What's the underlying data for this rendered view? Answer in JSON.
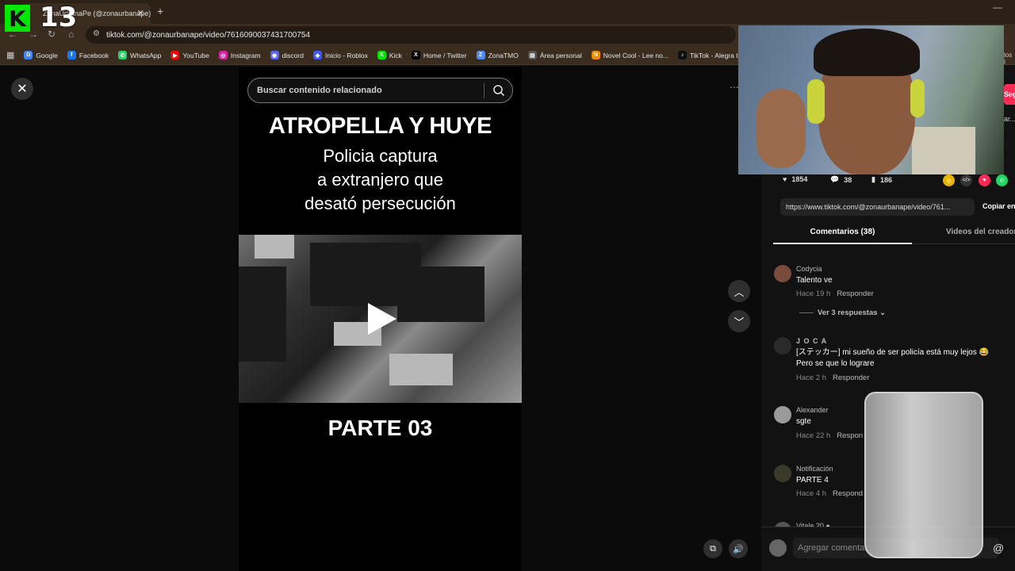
{
  "browser": {
    "tab_title": "ZonaUrbanaPe (@zonaurbanape)",
    "tab_close": "✕",
    "new_tab": "+",
    "url": "tiktok.com/@zonaurbanape/video/7616090037431700754",
    "bookmarks": [
      {
        "label": "Google",
        "icon": "google-icon",
        "color": "#4285f4",
        "glyph": "G"
      },
      {
        "label": "Facebook",
        "icon": "facebook-icon",
        "color": "#1877f2",
        "glyph": "f"
      },
      {
        "label": "WhatsApp",
        "icon": "whatsapp-icon",
        "color": "#25d366",
        "glyph": "✆"
      },
      {
        "label": "YouTube",
        "icon": "youtube-icon",
        "color": "#ff0000",
        "glyph": "▶"
      },
      {
        "label": "Instagram",
        "icon": "instagram-icon",
        "color": "#d6249f",
        "glyph": "◎"
      },
      {
        "label": "discord",
        "icon": "discord-icon",
        "color": "#5865f2",
        "glyph": "◉"
      },
      {
        "label": "Inicio - Roblox",
        "icon": "roblox-icon",
        "color": "#3d5afe",
        "glyph": "◆"
      },
      {
        "label": "Kick",
        "icon": "kick-icon",
        "color": "#00e701",
        "glyph": "K"
      },
      {
        "label": "Home / Twitter",
        "icon": "x-icon",
        "color": "#000000",
        "glyph": "X"
      },
      {
        "label": "ZonaTMO",
        "icon": "zonatmo-icon",
        "color": "#4a8cff",
        "glyph": "Z"
      },
      {
        "label": "Área personal",
        "icon": "area-icon",
        "color": "#555555",
        "glyph": "▤"
      },
      {
        "label": "Novel Cool - Lee no...",
        "icon": "novelcool-icon",
        "color": "#f08a00",
        "glyph": "N"
      },
      {
        "label": "TikTok - Alegra tu",
        "icon": "tiktok-icon",
        "color": "#111111",
        "glyph": "♪"
      }
    ],
    "bookmarks_more": "los l"
  },
  "overlay": {
    "kick_glyph": "K",
    "kick_number": "13"
  },
  "viewer": {
    "search_placeholder": "Buscar contenido relacionado",
    "headline": "ATROPELLA Y HUYE",
    "subline_1": "Policia captura",
    "subline_2": "a extranjero que",
    "subline_3": "desató persecución",
    "part_label": "PARTE 03"
  },
  "panel": {
    "follow_label": "Seg",
    "partial_text": "ar...",
    "likes": "1854",
    "comments_count": "38",
    "saves": "186",
    "link": "https://www.tiktok.com/@zonaurbanape/video/761...",
    "copy_label": "Copiar en",
    "tab_comments": "Comentarios (38)",
    "tab_creator": "Videos del creador",
    "comments": [
      {
        "user": "Codycia",
        "text": "Talento ve",
        "time": "Hace 19 h",
        "reply": "Responder",
        "avatar": "#7a4a3a"
      },
      {
        "user": "J O C A",
        "text": "[ステッカー] mi sueño de ser policía está muy lejos 😂",
        "text2": "Pero se que lo lograre",
        "time": "Hace 2 h",
        "reply": "Responder",
        "avatar": "#2a2a2a"
      },
      {
        "user": "Alexander",
        "text": "sgte",
        "time": "Hace 22 h",
        "reply": "Respon",
        "avatar": "#9a9a9a"
      },
      {
        "user": "Notificación",
        "text": "PARTE 4",
        "time": "Hace 4 h",
        "reply": "Respond",
        "avatar": "#3a3a2a"
      },
      {
        "user": "Vitale 20 ●",
        "avatar": "#555555"
      }
    ],
    "view_replies": "Ver 3 respuestas",
    "add_comment_placeholder": "Agregar comentar"
  },
  "colors": {
    "accent": "#fe2c55",
    "kick_green": "#00e701"
  }
}
